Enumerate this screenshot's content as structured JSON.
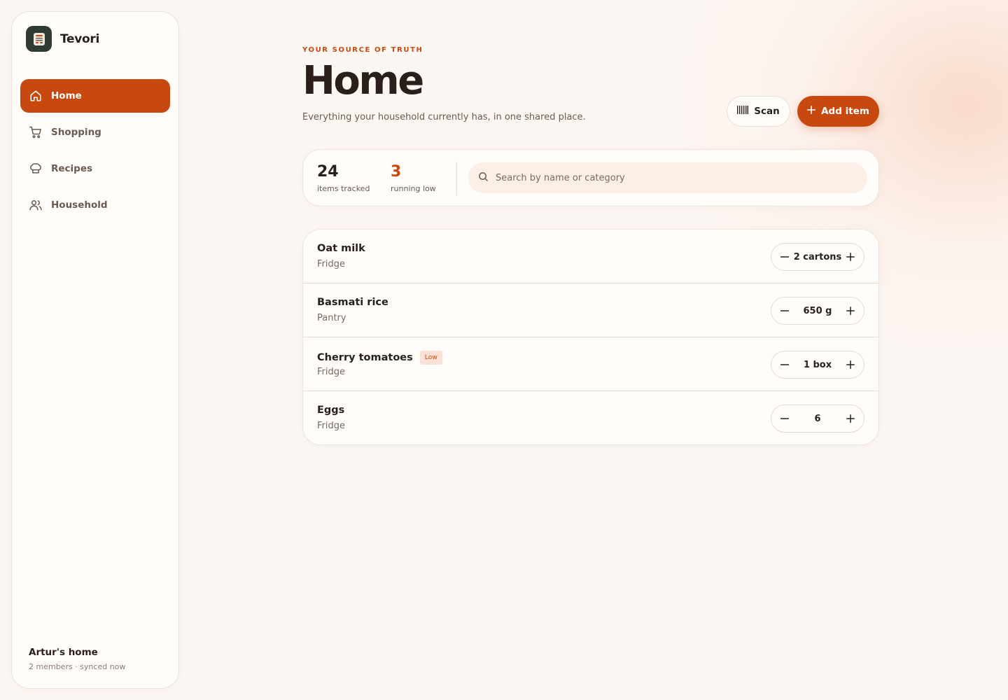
{
  "app": {
    "name": "Tevori"
  },
  "sidebar": {
    "items": [
      {
        "label": "Home",
        "icon": "home-icon",
        "active": true
      },
      {
        "label": "Shopping",
        "icon": "cart-icon",
        "active": false
      },
      {
        "label": "Recipes",
        "icon": "chef-hat-icon",
        "active": false
      },
      {
        "label": "Household",
        "icon": "users-icon",
        "active": false
      }
    ],
    "footer": {
      "name": "Artur's home",
      "sub": "2 members · synced now"
    }
  },
  "header": {
    "eyebrow": "YOUR SOURCE OF TRUTH",
    "title": "Home",
    "subtitle": "Everything your household currently has, in one shared place.",
    "scan_label": "Scan",
    "add_label": "Add item"
  },
  "stats": {
    "tracked_value": "24",
    "tracked_label": "items tracked",
    "low_value": "3",
    "low_label": "running low"
  },
  "search": {
    "placeholder": "Search by name or category",
    "value": ""
  },
  "items": [
    {
      "name": "Oat milk",
      "location": "Fridge",
      "quantity": "2 cartons",
      "badge": ""
    },
    {
      "name": "Basmati rice",
      "location": "Pantry",
      "quantity": "650 g",
      "badge": ""
    },
    {
      "name": "Cherry tomatoes",
      "location": "Fridge",
      "quantity": "1 box",
      "badge": "Low"
    },
    {
      "name": "Eggs",
      "location": "Fridge",
      "quantity": "6",
      "badge": ""
    }
  ],
  "colors": {
    "accent": "#c8490f",
    "background": "#fdf7f3",
    "card": "#fffcfa",
    "text": "#2a1f1a",
    "muted": "#6b5a50",
    "low_badge_bg": "#fbe0d6"
  }
}
